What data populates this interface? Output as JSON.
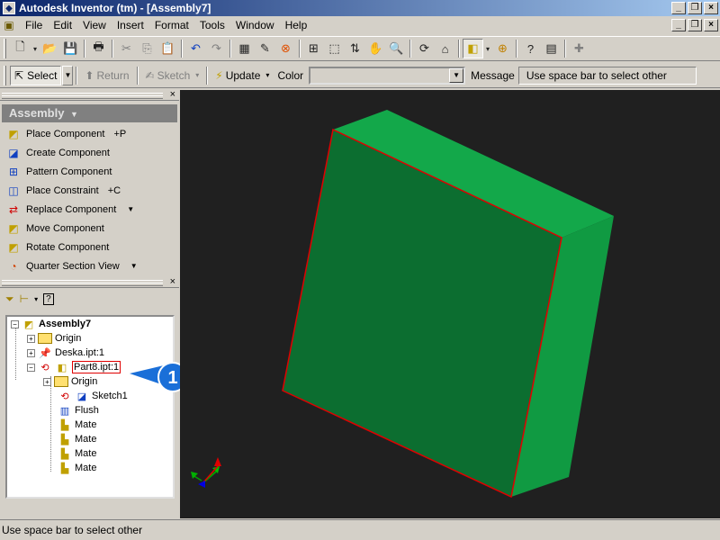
{
  "window": {
    "title": "Autodesk Inventor (tm) - [Assembly7]",
    "app_icon": "inventor-logo-icon"
  },
  "menu": [
    "File",
    "Edit",
    "View",
    "Insert",
    "Format",
    "Tools",
    "Window",
    "Help"
  ],
  "toolbar2": {
    "select_label": "Select",
    "return_label": "Return",
    "sketch_label": "Sketch",
    "update_label": "Update",
    "color_label": "Color",
    "color_value": "",
    "message_label": "Message",
    "message_value": "Use space bar to select other"
  },
  "panel": {
    "header": "Assembly",
    "commands": [
      {
        "label": "Place Component",
        "shortcut": "+P",
        "icon": "place-component-icon"
      },
      {
        "label": "Create Component",
        "shortcut": "",
        "icon": "create-component-icon"
      },
      {
        "label": "Pattern Component",
        "shortcut": "",
        "icon": "pattern-component-icon"
      },
      {
        "label": "Place Constraint",
        "shortcut": "+C",
        "icon": "place-constraint-icon"
      },
      {
        "label": "Replace Component",
        "shortcut": "",
        "icon": "replace-component-icon"
      },
      {
        "label": "Move Component",
        "shortcut": "",
        "icon": "move-component-icon"
      },
      {
        "label": "Rotate Component",
        "shortcut": "",
        "icon": "rotate-component-icon"
      },
      {
        "label": "Quarter Section View",
        "shortcut": "",
        "icon": "section-view-icon"
      }
    ]
  },
  "tree": {
    "root": "Assembly7",
    "origin": "Origin",
    "deska": "Deska.ipt:1",
    "part8": "Part8.ipt:1",
    "part8_origin": "Origin",
    "sketch": "Sketch1",
    "flush": "Flush",
    "mate1": "Mate",
    "mate2": "Mate",
    "mate3": "Mate",
    "mate4": "Mate"
  },
  "callout": {
    "number": "1",
    "color": "#1a6fd8"
  },
  "status": "Use space bar to select other",
  "colors": {
    "viewport_bg": "#202020",
    "model_front": "#0c6e30",
    "model_top": "#13a84a",
    "model_side": "#109a42",
    "edge_highlight": "#e00000"
  }
}
